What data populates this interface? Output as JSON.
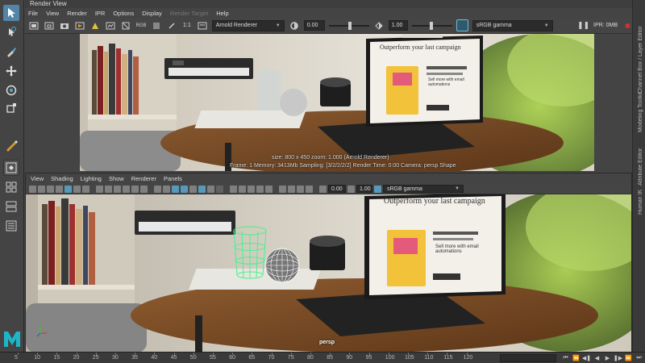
{
  "render_view": {
    "title": "Render View",
    "menu": [
      "File",
      "View",
      "Render",
      "IPR",
      "Options",
      "Display",
      "Render Target",
      "Help"
    ],
    "menu_disabled_index": 6,
    "toolbar": {
      "ratio_label": "1:1",
      "renderer": "Arnold Renderer",
      "exposure_value": "0.00",
      "gamma_value": "1.00",
      "color_space": "sRGB gamma",
      "ipr_memory": "IPR: 0MB"
    },
    "status_line1": "size: 800 x 450  zoom: 1.000    (Arnold Renderer)",
    "status_line2": "Frame: 1    Memory: 3413Mb    Sampling: [3/2/2/2/2]    Render Time: 0:00    Camera: persp Shape",
    "laptop_headline": "Outperform your last campaign",
    "laptop_sub": "Sell more with email automations"
  },
  "viewport": {
    "menu": [
      "View",
      "Shading",
      "Lighting",
      "Show",
      "Renderer",
      "Panels"
    ],
    "exposure_value": "0.00",
    "gamma_value": "1.00",
    "color_space": "sRGB gamma",
    "camera": "persp",
    "laptop_headline": "Outperform your last campaign",
    "laptop_sub": "Sell more with email automations"
  },
  "right_tabs": [
    "Channel Box / Layer Editor",
    "Modeling Toolkit",
    "Attribute Editor",
    "Human IK"
  ],
  "timeline": {
    "ticks": [
      "5",
      "10",
      "15",
      "20",
      "25",
      "30",
      "35",
      "40",
      "45",
      "50",
      "55",
      "60",
      "65",
      "70",
      "75",
      "80",
      "85",
      "90",
      "95",
      "100",
      "105",
      "110",
      "115",
      "120"
    ]
  },
  "colors": {
    "accent": "#5285a6",
    "panel": "#444444",
    "wireframe": "#46f28c",
    "maya_logo": "#1fb5c9"
  }
}
